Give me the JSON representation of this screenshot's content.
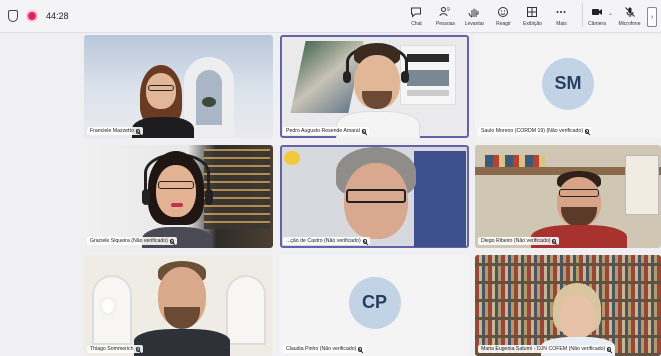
{
  "meeting": {
    "timer": "44:28"
  },
  "toolbar": {
    "actions": [
      {
        "label": "Chat",
        "icon": "chat-icon"
      },
      {
        "label": "Pessoas",
        "icon": "people-icon",
        "badge": "9"
      },
      {
        "label": "Levantar",
        "icon": "raise-hand-icon"
      },
      {
        "label": "Reagir",
        "icon": "react-icon"
      },
      {
        "label": "Exibição",
        "icon": "view-icon"
      },
      {
        "label": "Mais",
        "icon": "more-icon"
      },
      {
        "label": "Câmera",
        "icon": "camera-icon"
      },
      {
        "label": "Microfone",
        "icon": "microphone-icon"
      }
    ]
  },
  "participants": [
    {
      "name": "Franciele Mazzetto",
      "muted": true
    },
    {
      "name": "Pedro Augusto Resende Amaral",
      "muted": true
    },
    {
      "name": "Saulo Moreno (CORDM 19) (Não verificado)",
      "muted": true,
      "initials": "SM"
    },
    {
      "name": "Graciele Siqueira (Não verificado)",
      "muted": true
    },
    {
      "name": "...ção de Castro (Não verificado)",
      "muted": true
    },
    {
      "name": "Diego Ribeiro (Não verificado)",
      "muted": true
    },
    {
      "name": "Thiago Sommerich",
      "muted": true
    },
    {
      "name": "Claudia Pinho (Não verificado)",
      "muted": true,
      "initials": "CP"
    },
    {
      "name": "Maria Eugenia Saturni - DJN COFEM (Não verificado)",
      "muted": true
    }
  ],
  "colors": {
    "accent": "#6264a7",
    "record": "#e0245e",
    "avatar_bg": "#c2d3e6"
  }
}
